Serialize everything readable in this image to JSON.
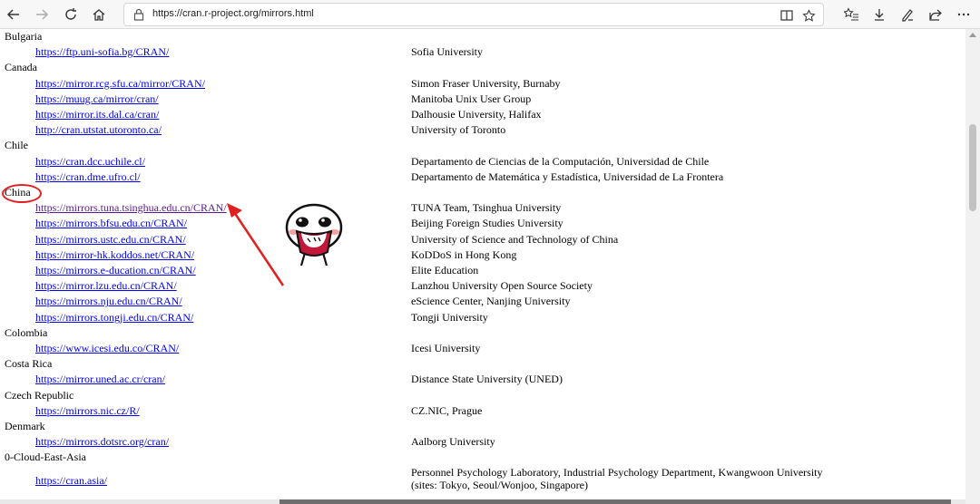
{
  "browser": {
    "url": "https://cran.r-project.org/mirrors.html",
    "icons": [
      "back-icon",
      "forward-icon",
      "refresh-icon",
      "home-icon",
      "lock-icon",
      "reader-view-icon",
      "favorite-star-icon",
      "favorites-list-icon",
      "download-icon",
      "pen-icon",
      "share-icon",
      "more-icon"
    ]
  },
  "mirrors": [
    {
      "country": "Bulgaria",
      "sites": [
        {
          "url": "https://ftp.uni-sofia.bg/CRAN/",
          "host": "Sofia University"
        }
      ]
    },
    {
      "country": "Canada",
      "sites": [
        {
          "url": "https://mirror.rcg.sfu.ca/mirror/CRAN/",
          "host": "Simon Fraser University, Burnaby"
        },
        {
          "url": "https://muug.ca/mirror/cran/",
          "host": "Manitoba Unix User Group"
        },
        {
          "url": "https://mirror.its.dal.ca/cran/",
          "host": "Dalhousie University, Halifax"
        },
        {
          "url": "http://cran.utstat.utoronto.ca/",
          "host": "University of Toronto"
        }
      ]
    },
    {
      "country": "Chile",
      "sites": [
        {
          "url": "https://cran.dcc.uchile.cl/",
          "host": "Departamento de Ciencias de la Computación, Universidad de Chile"
        },
        {
          "url": "https://cran.dme.ufro.cl/",
          "host": "Departamento de Matemática y Estadística, Universidad de La Frontera"
        }
      ]
    },
    {
      "country": "China",
      "sites": [
        {
          "url": "https://mirrors.tuna.tsinghua.edu.cn/CRAN/",
          "host": "TUNA Team, Tsinghua University"
        },
        {
          "url": "https://mirrors.bfsu.edu.cn/CRAN/",
          "host": "Beijing Foreign Studies University"
        },
        {
          "url": "https://mirrors.ustc.edu.cn/CRAN/",
          "host": "University of Science and Technology of China"
        },
        {
          "url": "https://mirror-hk.koddos.net/CRAN/",
          "host": "KoDDoS in Hong Kong"
        },
        {
          "url": "https://mirrors.e-ducation.cn/CRAN/",
          "host": "Elite Education"
        },
        {
          "url": "https://mirror.lzu.edu.cn/CRAN/",
          "host": "Lanzhou University Open Source Society"
        },
        {
          "url": "https://mirrors.nju.edu.cn/CRAN/",
          "host": "eScience Center, Nanjing University"
        },
        {
          "url": "https://mirrors.tongji.edu.cn/CRAN/",
          "host": "Tongji University"
        }
      ]
    },
    {
      "country": "Colombia",
      "sites": [
        {
          "url": "https://www.icesi.edu.co/CRAN/",
          "host": "Icesi University"
        }
      ]
    },
    {
      "country": "Costa Rica",
      "sites": [
        {
          "url": "https://mirror.uned.ac.cr/cran/",
          "host": "Distance State University (UNED)"
        }
      ]
    },
    {
      "country": "Czech Republic",
      "sites": [
        {
          "url": "https://mirrors.nic.cz/R/",
          "host": "CZ.NIC, Prague"
        }
      ]
    },
    {
      "country": "Denmark",
      "sites": [
        {
          "url": "https://mirrors.dotsrc.org/cran/",
          "host": "Aalborg University"
        }
      ]
    },
    {
      "country": "0-Cloud-East-Asia",
      "sites": [
        {
          "url": "https://cran.asia/",
          "host": "Personnel Psychology Laboratory, Industrial Psychology Department, Kwangwoon University",
          "host_line2": "(sites: Tokyo, Seoul/Wonjoo, Singapore)"
        }
      ]
    }
  ],
  "annotation": {
    "circle_color": "#e02020",
    "arrow_color": "#e02020"
  }
}
